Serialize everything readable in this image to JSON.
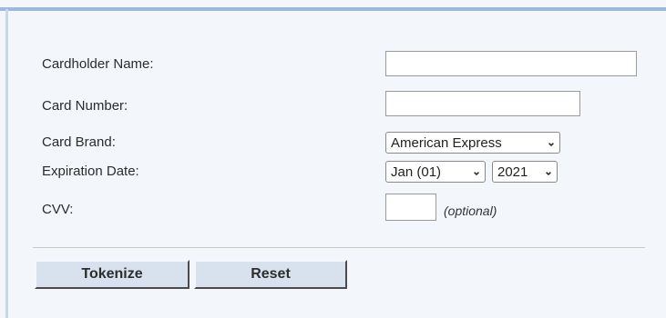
{
  "form": {
    "cardholder_name_label": "Cardholder Name:",
    "cardholder_name_value": "",
    "card_number_label": "Card Number:",
    "card_number_value": "",
    "card_brand_label": "Card Brand:",
    "card_brand_selected": "American Express",
    "expiration_date_label": "Expiration Date:",
    "expiration_month_selected": "Jan (01)",
    "expiration_year_selected": "2021",
    "cvv_label": "CVV:",
    "cvv_value": "",
    "cvv_optional_note": "(optional)"
  },
  "buttons": {
    "tokenize_label": "Tokenize",
    "reset_label": "Reset"
  },
  "colors": {
    "panel_background": "#f3f7fb",
    "top_border": "#9db8d8",
    "button_face": "#d8e2ee"
  }
}
